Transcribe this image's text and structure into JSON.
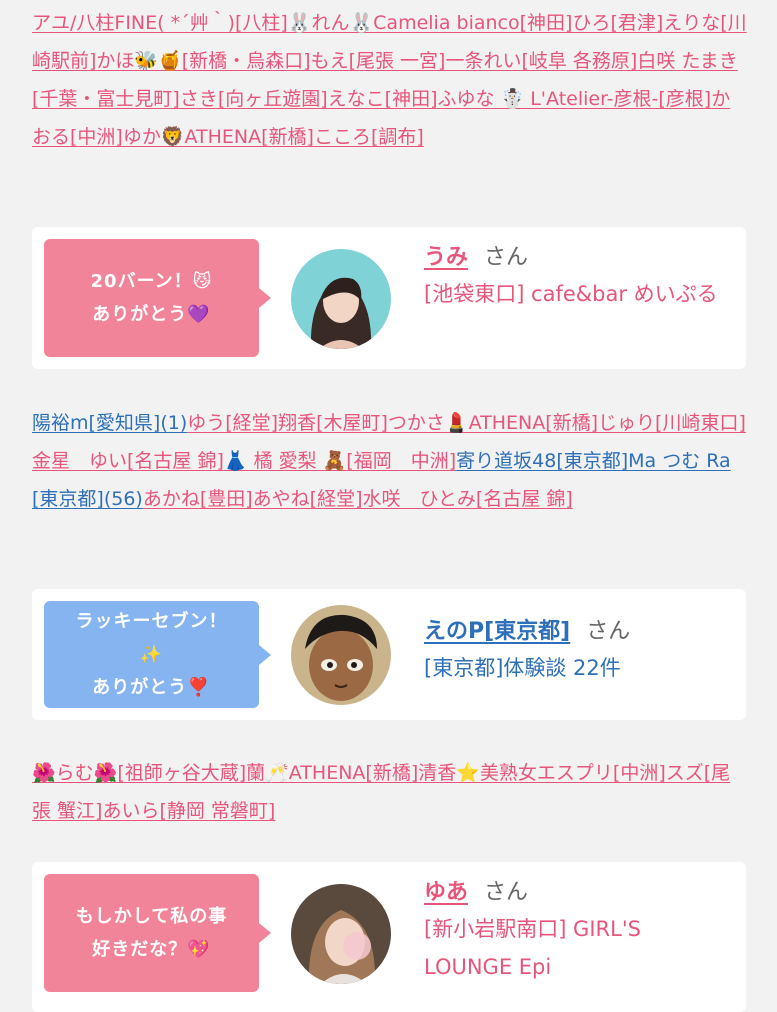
{
  "colors": {
    "pink": "#e8557a",
    "blue": "#2d6fb8",
    "bubble_pink": "#f2849a",
    "bubble_blue": "#86b4f0"
  },
  "block1": [
    {
      "t": "アユ/八柱FINE( *´艸｀)[八柱]",
      "c": "p"
    },
    {
      "t": "🐰れん🐰Camelia bianco[神田]",
      "c": "p"
    },
    {
      "t": "ひろ[君津]",
      "c": "p"
    },
    {
      "t": "えりな[川崎駅前]",
      "c": "p"
    },
    {
      "t": "かほ🐝🍯[新橋・烏森口]",
      "c": "p"
    },
    {
      "t": "もえ[尾張 一宮]",
      "c": "p"
    },
    {
      "t": "一条れい[岐阜 各務原]",
      "c": "p"
    },
    {
      "t": "白咲 たまき[千葉・富士見町]",
      "c": "p"
    },
    {
      "t": "さき[向ヶ丘遊園]",
      "c": "p"
    },
    {
      "t": "えなこ[神田]",
      "c": "p"
    },
    {
      "t": "ふゆな ☃️ L'Atelier-彦根-[彦根]",
      "c": "p"
    },
    {
      "t": "かおる[中洲]",
      "c": "p"
    },
    {
      "t": "ゆか🦁ATHENA[新橋]",
      "c": "p"
    },
    {
      "t": "こころ[調布]",
      "c": "p"
    }
  ],
  "card1": {
    "bubble_line1": "20バーン！😼",
    "bubble_line2": "ありがとう💜",
    "name": "うみ",
    "san": "さん",
    "shop": "[池袋東口] cafe&bar めいぷる"
  },
  "block2": [
    {
      "t": "陽裕m[愛知県](1)",
      "c": "b"
    },
    {
      "t": "ゆう[経堂]",
      "c": "p"
    },
    {
      "t": "翔香[木屋町]",
      "c": "p"
    },
    {
      "t": "つかさ💄ATHENA[新橋]",
      "c": "p"
    },
    {
      "t": "じゅり[川崎東口]",
      "c": "p"
    },
    {
      "t": "金星　ゆい[名古屋 錦]",
      "c": "p"
    },
    {
      "t": "👗 橘 愛梨 🧸[福岡　中洲]",
      "c": "p"
    },
    {
      "t": "寄り道坂48[東京都]",
      "c": "b"
    },
    {
      "t": "Ma つむ Ra[東京都](56)",
      "c": "b"
    },
    {
      "t": "あかね[豊田]",
      "c": "p"
    },
    {
      "t": "あやね[経堂]",
      "c": "p"
    },
    {
      "t": "水咲　ひとみ[名古屋 錦]",
      "c": "p"
    }
  ],
  "card2": {
    "bubble_line1": "ラッキーセブン！",
    "bubble_line2": "✨",
    "bubble_line3": "ありがとう❣️",
    "name": "えのP[東京都]",
    "san": "さん",
    "shop": "[東京都]体験談 22件"
  },
  "block3": [
    {
      "t": "🌺らむ🌺[祖師ヶ谷大蔵]",
      "c": "p"
    },
    {
      "t": "蘭🥂ATHENA[新橋]",
      "c": "p"
    },
    {
      "t": "清香⭐美熟女エスプリ[中洲]",
      "c": "p"
    },
    {
      "t": "スズ[尾張 蟹江]",
      "c": "p"
    },
    {
      "t": "あいら[静岡 常磐町]",
      "c": "p"
    }
  ],
  "card3": {
    "bubble_line1": "もしかして私の事",
    "bubble_line2": "好きだな？💖",
    "name": "ゆあ",
    "san": "さん",
    "shop": "[新小岩駅南口] GIRL'S LOUNGE Epi"
  }
}
